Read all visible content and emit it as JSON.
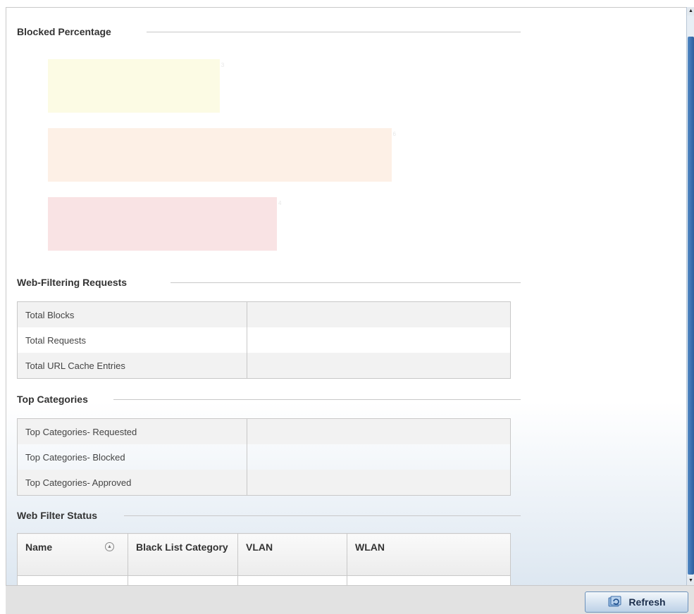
{
  "sections": {
    "blocked": "Blocked Percentage",
    "requests": "Web-Filtering Requests",
    "categories": "Top Categories",
    "status": "Web Filter Status"
  },
  "chart_data": {
    "type": "bar",
    "orientation": "horizontal",
    "title": "",
    "categories": [
      "",
      "",
      ""
    ],
    "values": [
      3,
      6,
      4
    ],
    "xlim": [
      0,
      8
    ],
    "bar_colors": [
      "#fcfbe4",
      "#fdf0e6",
      "#f9e3e4"
    ]
  },
  "requests": {
    "rows": [
      {
        "label": "Total Blocks",
        "value": ""
      },
      {
        "label": "Total Requests",
        "value": ""
      },
      {
        "label": "Total URL Cache Entries",
        "value": ""
      }
    ]
  },
  "categories": {
    "rows": [
      {
        "label": "Top Categories- Requested",
        "value": ""
      },
      {
        "label": "Top Categories- Blocked",
        "value": ""
      },
      {
        "label": "Top Categories- Approved",
        "value": ""
      }
    ]
  },
  "status_table": {
    "columns": [
      "Name",
      "Black List Category",
      "VLAN",
      "WLAN"
    ],
    "sort_icon": "sort-up-icon"
  },
  "footer": {
    "refresh_label": "Refresh",
    "refresh_icon": "refresh-icon"
  },
  "scrollbar": {
    "up_icon": "scroll-up-arrow-icon",
    "down_icon": "scroll-down-arrow-icon"
  }
}
